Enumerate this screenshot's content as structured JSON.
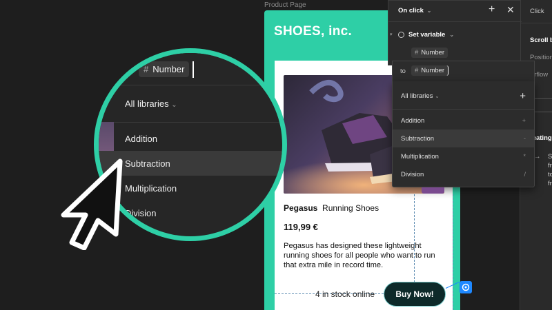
{
  "frame": {
    "label": "Product Page",
    "brand": "SHOES, inc.",
    "product": {
      "name_bold": "Pegasus",
      "name_rest": "Running Shoes",
      "price": "119,99 €",
      "description": "Pegasus has designed these lightweight running shoes for all people who want to run that extra mile in record time."
    },
    "stock": "4 in stock online",
    "buy_label": "Buy Now!"
  },
  "interaction": {
    "trigger": "On click",
    "action": "Set variable",
    "variable": "Number",
    "to_label": "to",
    "to_value": "Number"
  },
  "library": {
    "title": "All libraries",
    "items": [
      {
        "label": "Addition",
        "symbol": "+"
      },
      {
        "label": "Subtraction",
        "symbol": "-"
      },
      {
        "label": "Multiplication",
        "symbol": "*"
      },
      {
        "label": "Division",
        "symbol": "/"
      }
    ]
  },
  "magnifier": {
    "field": "Number",
    "title": "All libraries",
    "items": [
      "Addition",
      "Subtraction",
      "Multiplication",
      "Division"
    ]
  },
  "right_panel": {
    "tab": "Click",
    "section": "Scroll b",
    "rows": [
      "Position",
      "verflow"
    ],
    "creating": "reating",
    "lines": [
      "S",
      "fr",
      "to",
      "fr"
    ]
  },
  "colors": {
    "accent": "#2ecfa6",
    "canvas": "#1e1e1e",
    "panel": "#2b2b2b",
    "button": "#0e2a2a",
    "trigger": "#1e88ff"
  }
}
